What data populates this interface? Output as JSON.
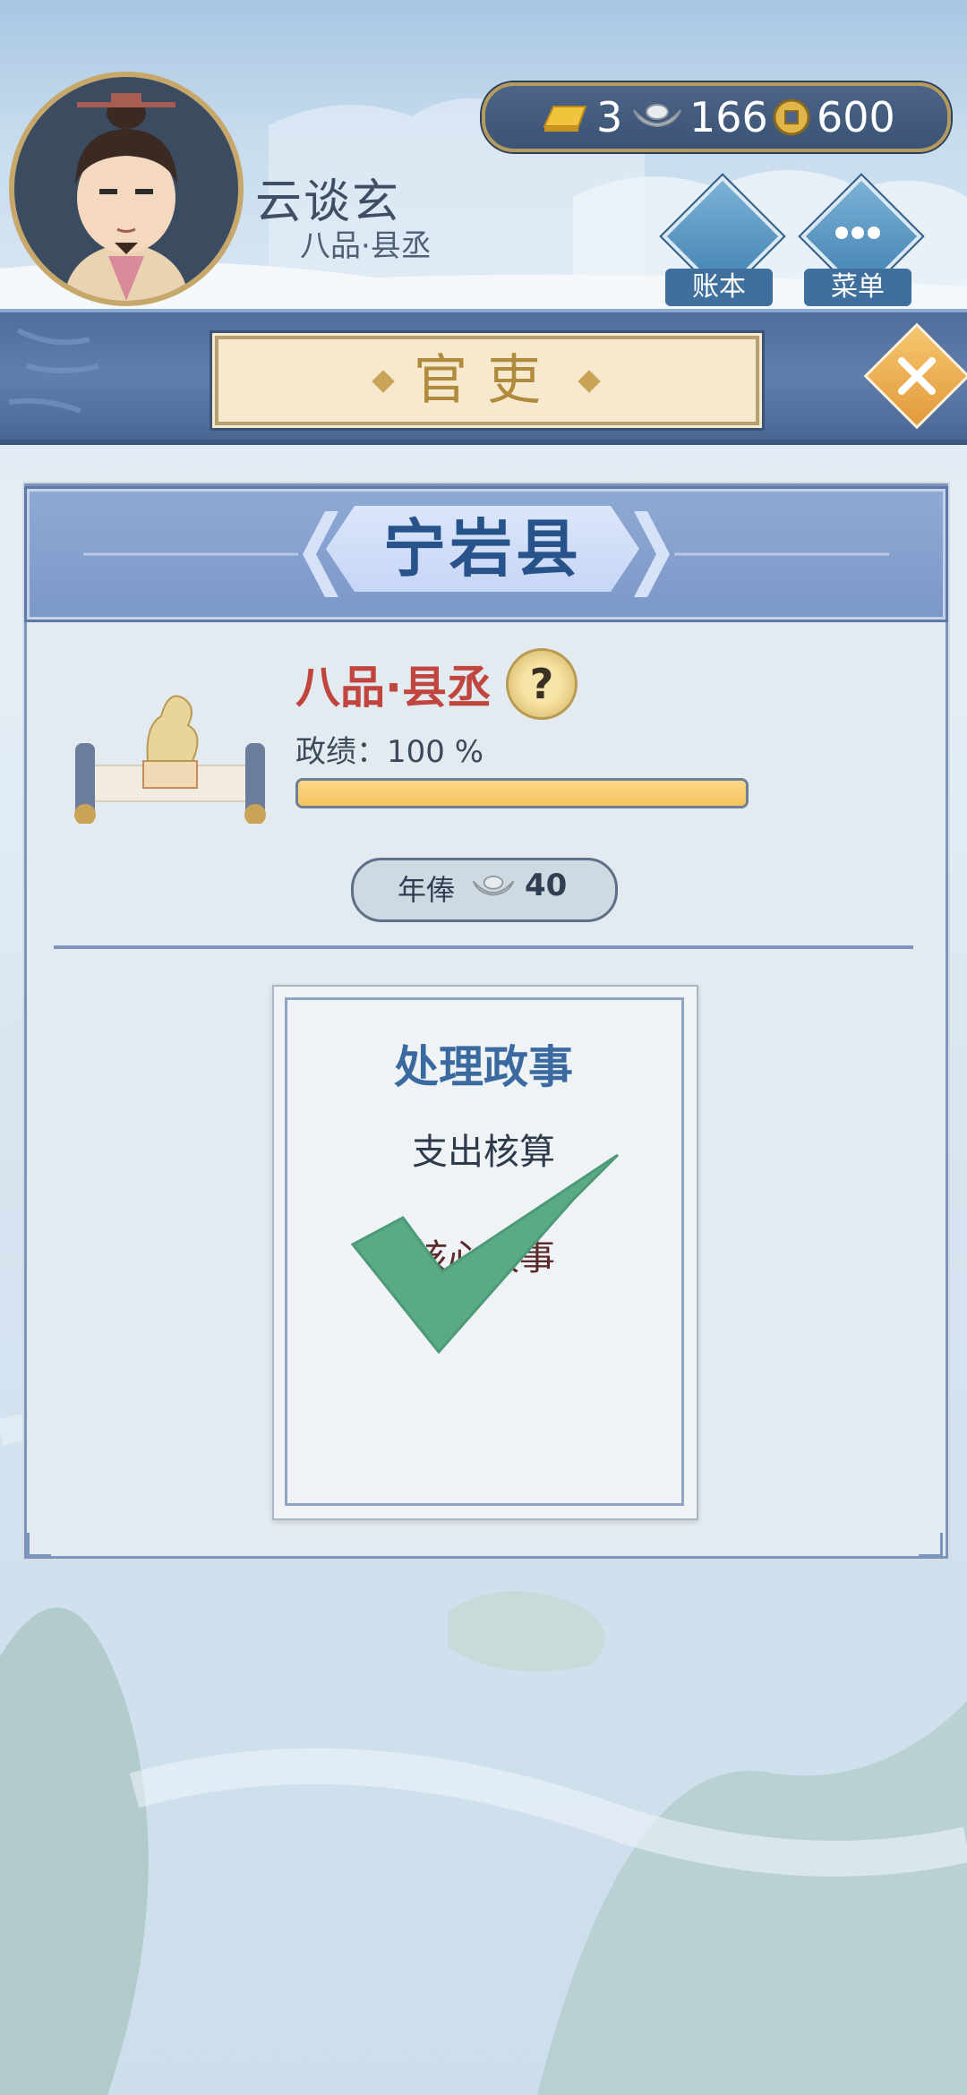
{
  "player": {
    "name": "云谈玄",
    "rank": "八品·县丞"
  },
  "currency": {
    "gold": "3",
    "silver": "166",
    "coins": "600",
    "gold_icon": "gold-bar-icon",
    "silver_icon": "silver-ingot-icon",
    "coin_icon": "copper-coin-icon"
  },
  "top_buttons": {
    "ledger_label": "账本",
    "menu_label": "菜单"
  },
  "header": {
    "title": "官吏"
  },
  "county": {
    "name": "宁岩县",
    "rank": "八品·县丞",
    "help_glyph": "?",
    "merit_label": "政绩：100 %",
    "merit_progress": 1.0,
    "salary_label": "年俸",
    "salary_value": "40"
  },
  "task_card": {
    "title": "处理政事",
    "items": [
      "支出核算",
      "核心政事"
    ],
    "completed": true
  },
  "colors": {
    "rank_red": "#c0453e",
    "title_gold": "#b08b3d",
    "panel_blue": "#7c98c8",
    "check_green": "#5aaa86",
    "progress_yellow": "#f5c35c"
  }
}
